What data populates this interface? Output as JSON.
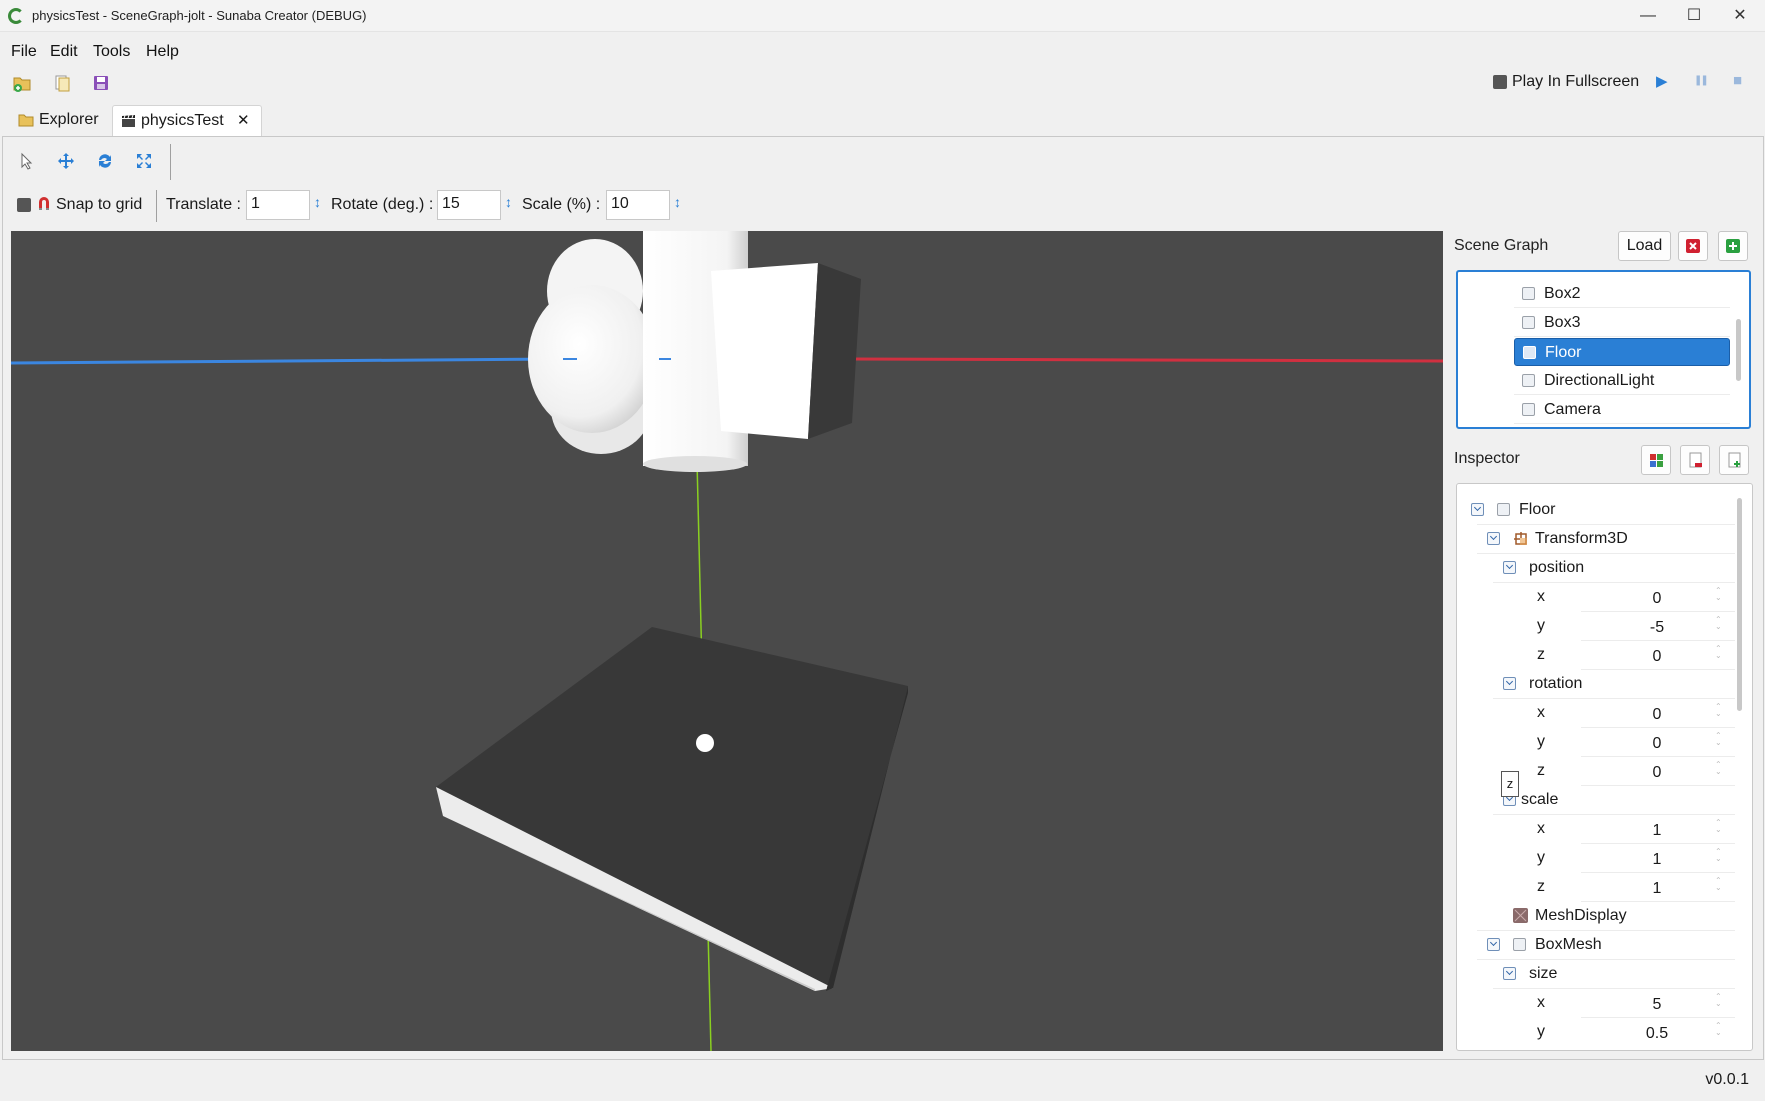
{
  "window": {
    "title": "physicsTest - SceneGraph-jolt - Sunaba Creator (DEBUG)",
    "minimize": "—",
    "maximize": "☐",
    "close": "✕"
  },
  "menu": {
    "items": [
      "File",
      "Edit",
      "Tools",
      "Help"
    ]
  },
  "play": {
    "fullscreen_label": "Play In Fullscreen",
    "play_icon": "▶",
    "pause_icon": "❚❚",
    "stop_icon": "■"
  },
  "tabs": {
    "explorer": "Explorer",
    "scene": "physicsTest",
    "close_icon": "✕"
  },
  "snap": {
    "label": "Snap to grid",
    "translate_label": "Translate :",
    "translate_value": "1",
    "rotate_label": "Rotate (deg.) :",
    "rotate_value": "15",
    "scale_label": "Scale (%) :",
    "scale_value": "10"
  },
  "scene_graph": {
    "title": "Scene Graph",
    "load_label": "Load",
    "items": [
      "Box2",
      "Box3",
      "Floor",
      "DirectionalLight",
      "Camera"
    ],
    "selected": "Floor"
  },
  "inspector": {
    "title": "Inspector",
    "root": "Floor",
    "transform": "Transform3D",
    "position": {
      "label": "position",
      "x": "0",
      "y": "-5",
      "z": "0"
    },
    "rotation": {
      "label": "rotation",
      "x": "0",
      "y": "0",
      "z": "0"
    },
    "scale": {
      "label": "scale",
      "x": "1",
      "y": "1",
      "z": "1"
    },
    "mesh_display": "MeshDisplay",
    "box_mesh": "BoxMesh",
    "size": {
      "label": "size",
      "x": "5",
      "y": "0.5"
    },
    "axis": {
      "x": "x",
      "y": "y",
      "z": "z"
    },
    "tooltip": "z"
  },
  "status": {
    "version": "v0.0.1"
  }
}
